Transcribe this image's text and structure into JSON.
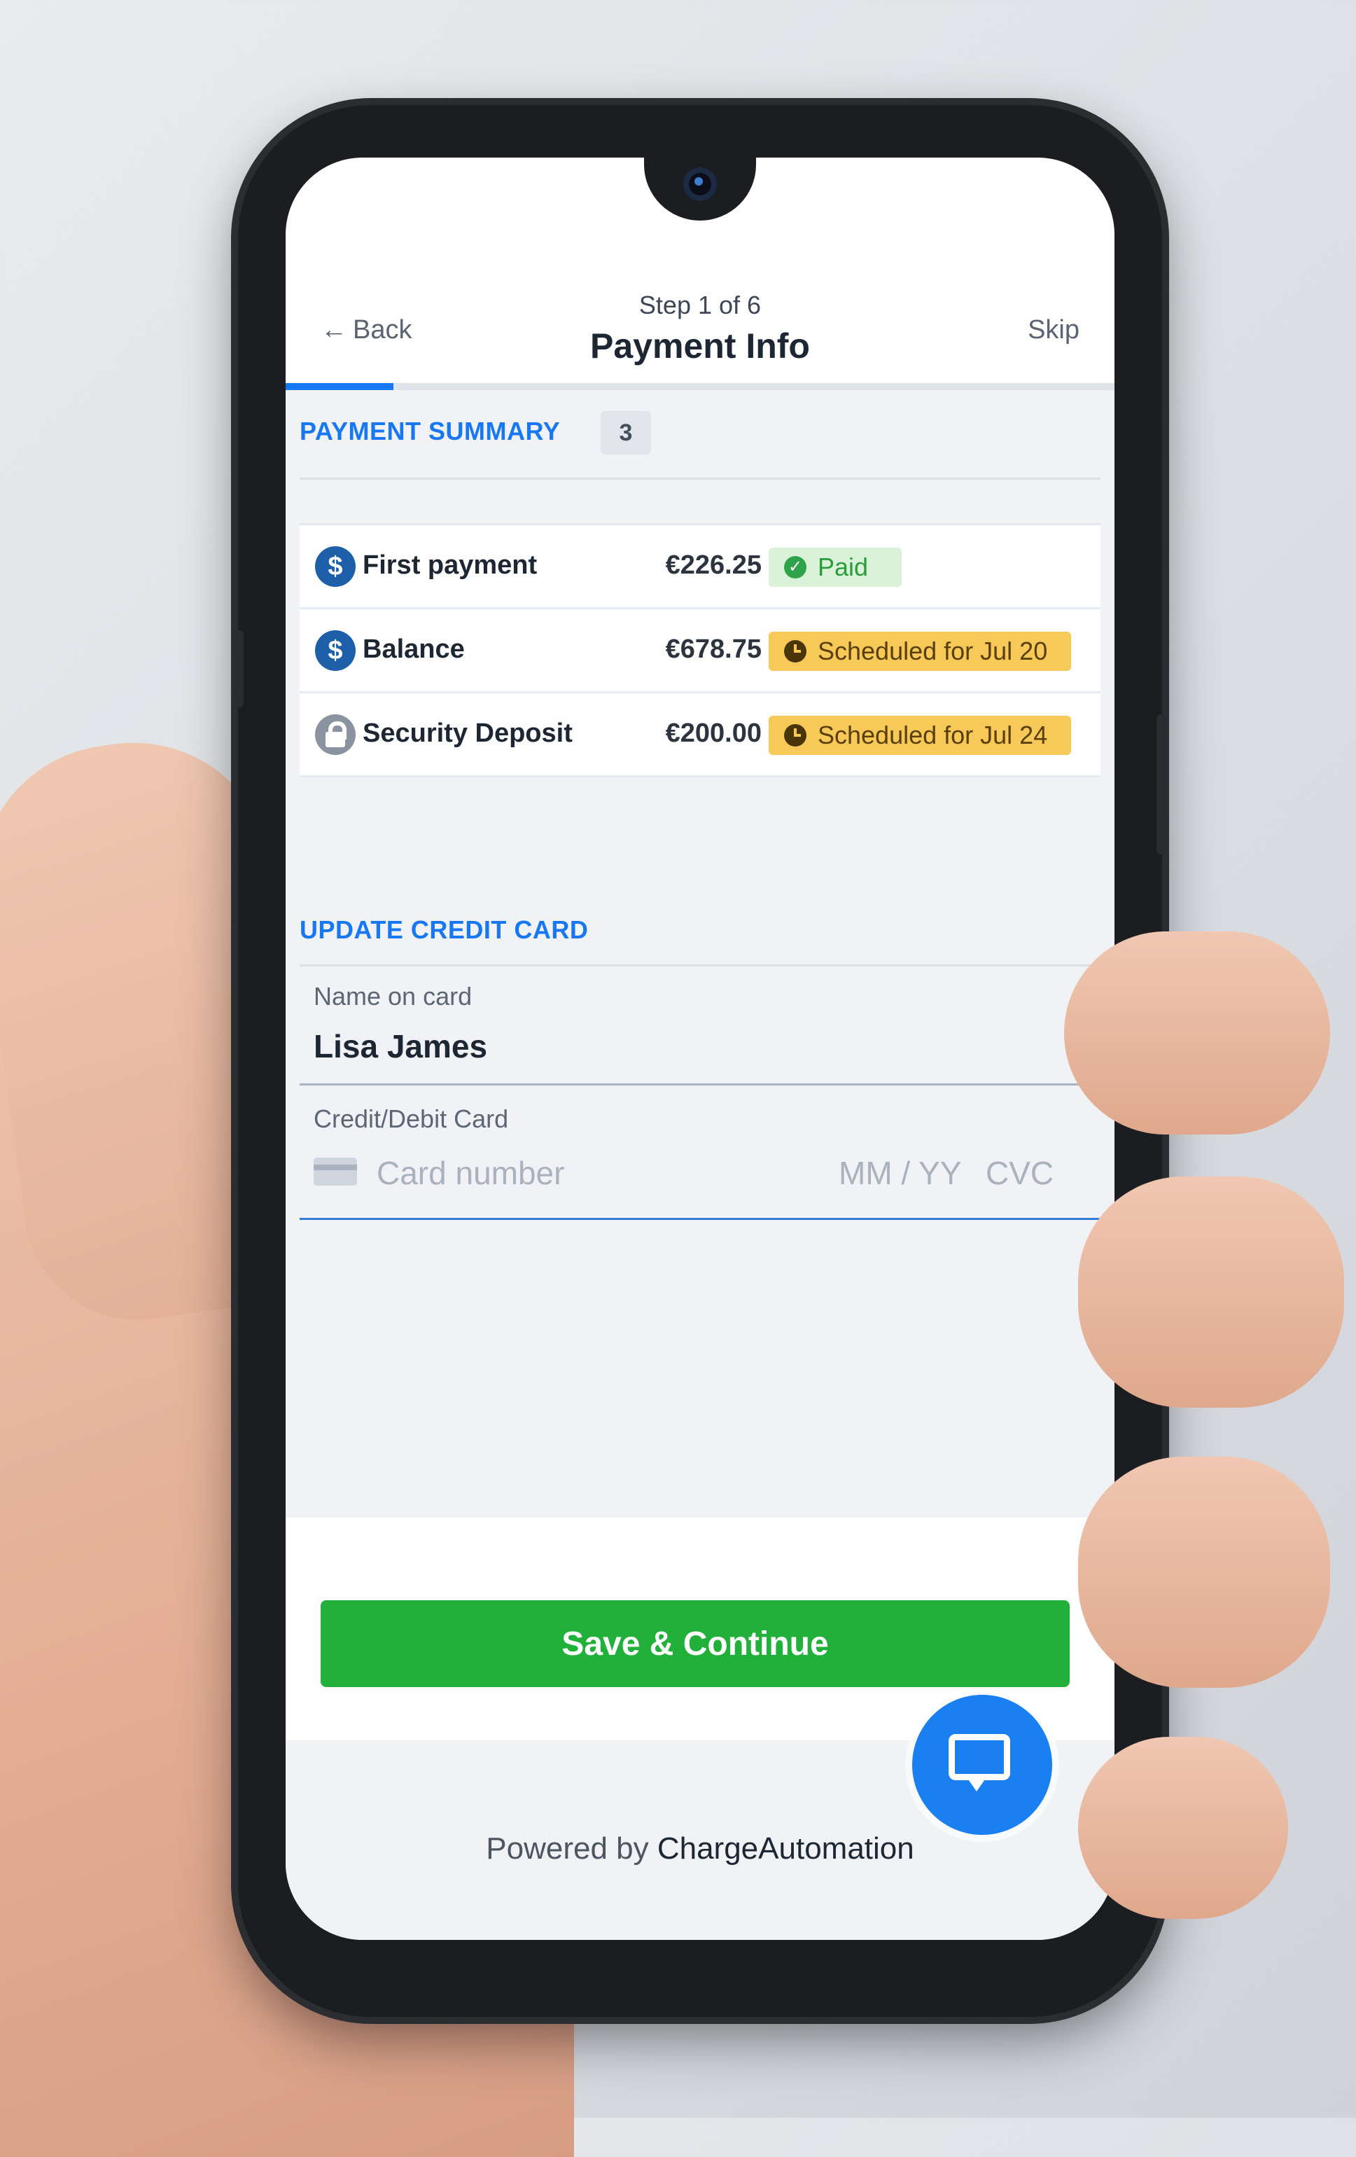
{
  "header": {
    "back_label": "Back",
    "back_icon": "arrow-left-icon",
    "step_label": "Step 1 of 6",
    "title": "Payment Info",
    "skip_label": "Skip",
    "progress_fraction": 0.13
  },
  "summary": {
    "heading": "PAYMENT SUMMARY",
    "count": "3",
    "rows": [
      {
        "icon": "dollar-icon",
        "icon_text": "$",
        "label": "First payment",
        "amount": "€226.25",
        "status": "Paid",
        "status_type": "paid",
        "status_icon": "check-circle-icon"
      },
      {
        "icon": "dollar-icon",
        "icon_text": "$",
        "label": "Balance",
        "amount": "€678.75",
        "status": "Scheduled for Jul 20",
        "status_type": "scheduled",
        "status_icon": "clock-icon"
      },
      {
        "icon": "lock-icon",
        "icon_text": "",
        "label": "Security Deposit",
        "amount": "€200.00",
        "status": "Scheduled for Jul 24",
        "status_type": "scheduled",
        "status_icon": "clock-icon"
      }
    ]
  },
  "card": {
    "heading": "UPDATE CREDIT CARD",
    "name_label": "Name on card",
    "name_value": "Lisa James",
    "card_label": "Credit/Debit Card",
    "card_placeholder": "Card number",
    "expiry_placeholder": "MM / YY",
    "cvc_placeholder": "CVC"
  },
  "actions": {
    "save_label": "Save & Continue"
  },
  "footer": {
    "powered_prefix": "Powered by",
    "brand": "ChargeAutomation",
    "chat_icon": "chat-bubble-icon"
  },
  "colors": {
    "accent": "#1877f2",
    "success": "#21b13b",
    "paid_bg": "#d9f2d8",
    "scheduled_bg": "#f6c958"
  }
}
